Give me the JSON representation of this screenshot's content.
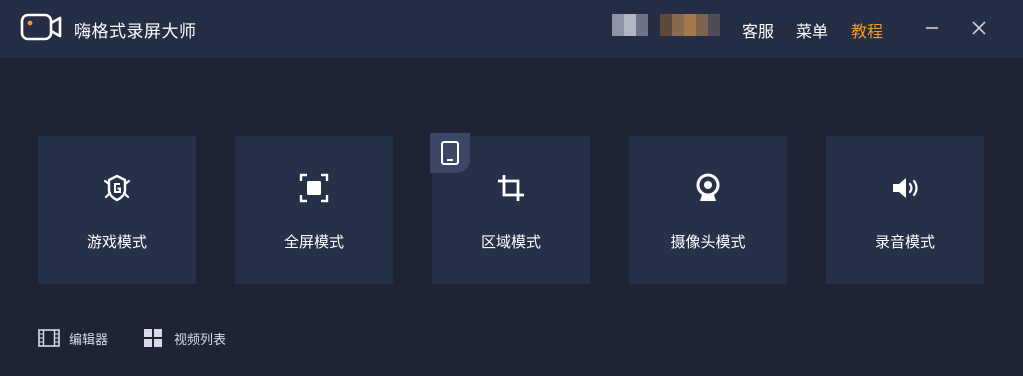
{
  "app": {
    "title": "嗨格式录屏大师"
  },
  "header": {
    "menu": [
      {
        "label": "客服"
      },
      {
        "label": "菜单"
      },
      {
        "label": "教程",
        "accent_color": "#f29b2c"
      }
    ],
    "account_blurred": true
  },
  "modes": [
    {
      "label": "游戏模式",
      "icon": "game-shield-icon"
    },
    {
      "label": "全屏模式",
      "icon": "fullscreen-icon"
    },
    {
      "label": "区域模式",
      "icon": "crop-icon",
      "badge_icon": "tablet-icon"
    },
    {
      "label": "摄像头模式",
      "icon": "webcam-icon"
    },
    {
      "label": "录音模式",
      "icon": "speaker-icon"
    }
  ],
  "footer": {
    "editor_label": "编辑器",
    "video_list_label": "视频列表"
  },
  "colors": {
    "background": "#1e2436",
    "titlebar": "#252d44",
    "card": "#273049",
    "accent": "#f29b2c"
  }
}
